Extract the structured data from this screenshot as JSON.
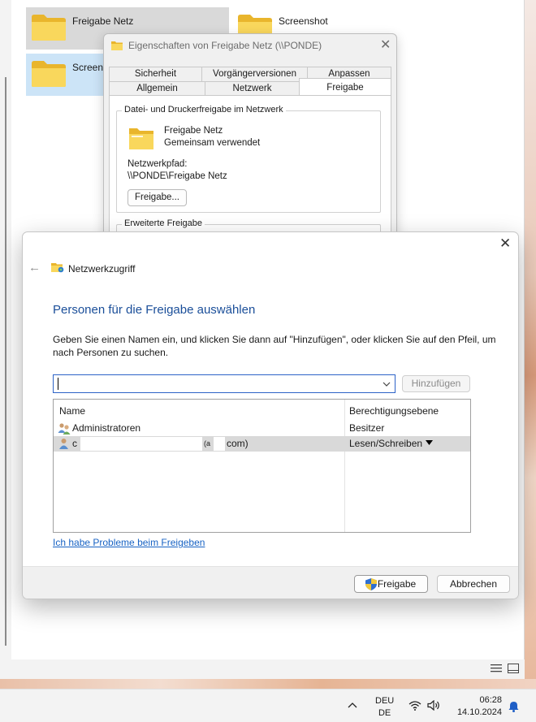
{
  "explorer": {
    "tiles": [
      {
        "name": "Freigabe Netz"
      },
      {
        "name": "Screenshot"
      },
      {
        "name": "Screens"
      }
    ]
  },
  "properties_dialog": {
    "title": "Eigenschaften von Freigabe Netz (\\\\PONDE)",
    "tabs_top": [
      "Sicherheit",
      "Vorgängerversionen",
      "Anpassen"
    ],
    "tabs_bottom": [
      "Allgemein",
      "Netzwerk",
      "Freigabe"
    ],
    "active_tab": "Freigabe",
    "group1_legend": "Datei- und Druckerfreigabe im Netzwerk",
    "folder_name": "Freigabe Netz",
    "folder_status": "Gemeinsam verwendet",
    "network_path_label": "Netzwerkpfad:",
    "network_path": "\\\\PONDE\\Freigabe Netz",
    "share_button": "Freigabe...",
    "group2_legend": "Erweiterte Freigabe"
  },
  "share_dialog": {
    "wizard_title": "Netzwerkzugriff",
    "heading": "Personen für die Freigabe auswählen",
    "instruction": "Geben Sie einen Namen ein, und klicken Sie dann auf \"Hinzufügen\", oder klicken Sie auf den Pfeil, um nach Personen zu suchen.",
    "input_value": "",
    "add_button": "Hinzufügen",
    "columns": [
      "Name",
      "Berechtigungsebene"
    ],
    "rows": [
      {
        "name": "Administratoren",
        "permission": "Besitzer",
        "icon": "group-icon"
      },
      {
        "name_prefix": "c",
        "name_mid": "(a",
        "name_suffix": "com)",
        "permission": "Lesen/Schreiben",
        "icon": "user-icon",
        "selected": true
      }
    ],
    "help_link": "Ich habe Probleme beim Freigeben",
    "share_button": "Freigabe",
    "cancel_button": "Abbrechen"
  },
  "taskbar": {
    "lang_top": "DEU",
    "lang_bottom": "DE",
    "time": "06:28",
    "date": "14.10.2024"
  },
  "colors": {
    "accent": "#1a4e99",
    "link": "#1863c4",
    "folder": "#f7c844",
    "selection": "#d9d9d9"
  }
}
